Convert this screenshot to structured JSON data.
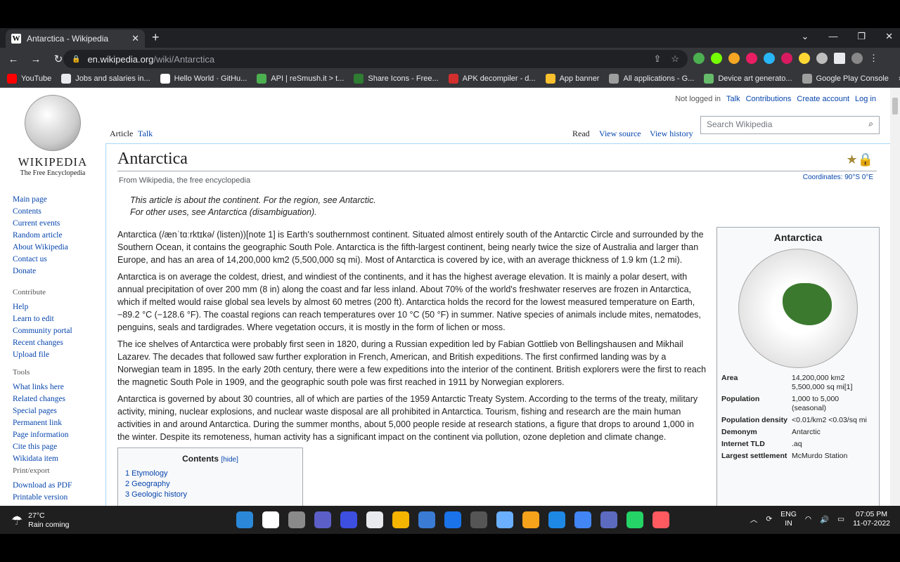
{
  "browser": {
    "tab_title": "Antarctica - Wikipedia",
    "tab_favicon": "W",
    "url_host": "en.wikipedia.org",
    "url_path": "/wiki/Antarctica",
    "bookmarks": [
      {
        "label": "YouTube",
        "color": "#ff0000"
      },
      {
        "label": "Jobs and salaries in...",
        "color": "#e8eaed"
      },
      {
        "label": "Hello World · GitHu...",
        "color": "#ffffff"
      },
      {
        "label": "API | reSmush.it > t...",
        "color": "#4caf50"
      },
      {
        "label": "Share Icons - Free...",
        "color": "#2e7d32"
      },
      {
        "label": "APK decompiler - d...",
        "color": "#d32f2f"
      },
      {
        "label": "App banner",
        "color": "#fbc02d"
      },
      {
        "label": "All applications - G...",
        "color": "#9e9e9e"
      },
      {
        "label": "Device art generato...",
        "color": "#66bb6a"
      },
      {
        "label": "Google Play Console",
        "color": "#9e9e9e"
      }
    ]
  },
  "wiki": {
    "logo_wordmark": "WIKIPEDIA",
    "logo_tagline": "The Free Encyclopedia",
    "nav_main": [
      "Main page",
      "Contents",
      "Current events",
      "Random article",
      "About Wikipedia",
      "Contact us",
      "Donate"
    ],
    "contribute_heading": "Contribute",
    "nav_contribute": [
      "Help",
      "Learn to edit",
      "Community portal",
      "Recent changes",
      "Upload file"
    ],
    "tools_heading": "Tools",
    "nav_tools": [
      "What links here",
      "Related changes",
      "Special pages",
      "Permanent link",
      "Page information",
      "Cite this page",
      "Wikidata item"
    ],
    "print_heading": "Print/export",
    "nav_print": [
      "Download as PDF",
      "Printable version"
    ],
    "personal": {
      "not_logged": "Not logged in",
      "talk": "Talk",
      "contributions": "Contributions",
      "create": "Create account",
      "login": "Log in"
    },
    "tabs": {
      "article": "Article",
      "talk": "Talk",
      "read": "Read",
      "view_source": "View source",
      "view_history": "View history"
    },
    "search_placeholder": "Search Wikipedia",
    "title": "Antarctica",
    "from": "From Wikipedia, the free encyclopedia",
    "coordinates": "Coordinates: 90°S 0°E",
    "hatnote_1": "This article is about the continent. For the region, see Antarctic.",
    "hatnote_2": "For other uses, see Antarctica (disambiguation).",
    "para_1": "Antarctica (/ænˈtɑːrktɪkə/ (listen))[note 1] is Earth's southernmost continent. Situated almost entirely south of the Antarctic Circle and surrounded by the Southern Ocean, it contains the geographic South Pole. Antarctica is the fifth-largest continent, being nearly twice the size of Australia and larger than Europe, and has an area of 14,200,000 km2 (5,500,000 sq mi). Most of Antarctica is covered by ice, with an average thickness of 1.9 km (1.2 mi).",
    "para_2": "Antarctica is on average the coldest, driest, and windiest of the continents, and it has the highest average elevation. It is mainly a polar desert, with annual precipitation of over 200 mm (8 in) along the coast and far less inland. About 70% of the world's freshwater reserves are frozen in Antarctica, which if melted would raise global sea levels by almost 60 metres (200 ft). Antarctica holds the record for the lowest measured temperature on Earth, −89.2 °C (−128.6 °F). The coastal regions can reach temperatures over 10 °C (50 °F) in summer. Native species of animals include mites, nematodes, penguins, seals and tardigrades. Where vegetation occurs, it is mostly in the form of lichen or moss.",
    "para_3": "The ice shelves of Antarctica were probably first seen in 1820, during a Russian expedition led by Fabian Gottlieb von Bellingshausen and Mikhail Lazarev. The decades that followed saw further exploration in French, American, and British expeditions. The first confirmed landing was by a Norwegian team in 1895. In the early 20th century, there were a few expeditions into the interior of the continent. British explorers were the first to reach the magnetic South Pole in 1909, and the geographic south pole was first reached in 1911 by Norwegian explorers.",
    "para_4": "Antarctica is governed by about 30 countries, all of which are parties of the 1959 Antarctic Treaty System. According to the terms of the treaty, military activity, mining, nuclear explosions, and nuclear waste disposal are all prohibited in Antarctica. Tourism, fishing and research are the main human activities in and around Antarctica. During the summer months, about 5,000 people reside at research stations, a figure that drops to around 1,000 in the winter. Despite its remoteness, human activity has a significant impact on the continent via pollution, ozone depletion and climate change.",
    "toc": {
      "heading": "Contents",
      "hide": "[hide]",
      "items": [
        "1 Etymology",
        "2 Geography",
        "3 Geologic history"
      ]
    },
    "infobox": {
      "caption": "Antarctica",
      "rows": [
        {
          "k": "Area",
          "v": "14,200,000 km2 5,500,000 sq mi[1]"
        },
        {
          "k": "Population",
          "v": "1,000 to 5,000 (seasonal)"
        },
        {
          "k": "Population density",
          "v": "<0.01/km2 <0.03/sq mi"
        },
        {
          "k": "Demonym",
          "v": "Antarctic"
        },
        {
          "k": "Internet TLD",
          "v": ".aq"
        },
        {
          "k": "Largest settlement",
          "v": "McMurdo Station"
        }
      ]
    }
  },
  "taskbar": {
    "temp": "27°C",
    "weather_desc": "Rain coming",
    "lang_1": "ENG",
    "lang_2": "IN",
    "time": "07:05 PM",
    "date": "11-07-2022",
    "apps": [
      "#2b88d8",
      "#ffffff",
      "#8a8a8a",
      "#5b5fc7",
      "#3c4fe0",
      "#e8eaed",
      "#f4b400",
      "#3a7bd5",
      "#1a73e8",
      "#555555",
      "#6ab0ff",
      "#f7a21b",
      "#1e88e5",
      "#4285f4",
      "#5c6bc0",
      "#25d366",
      "#ff5a5f"
    ]
  }
}
